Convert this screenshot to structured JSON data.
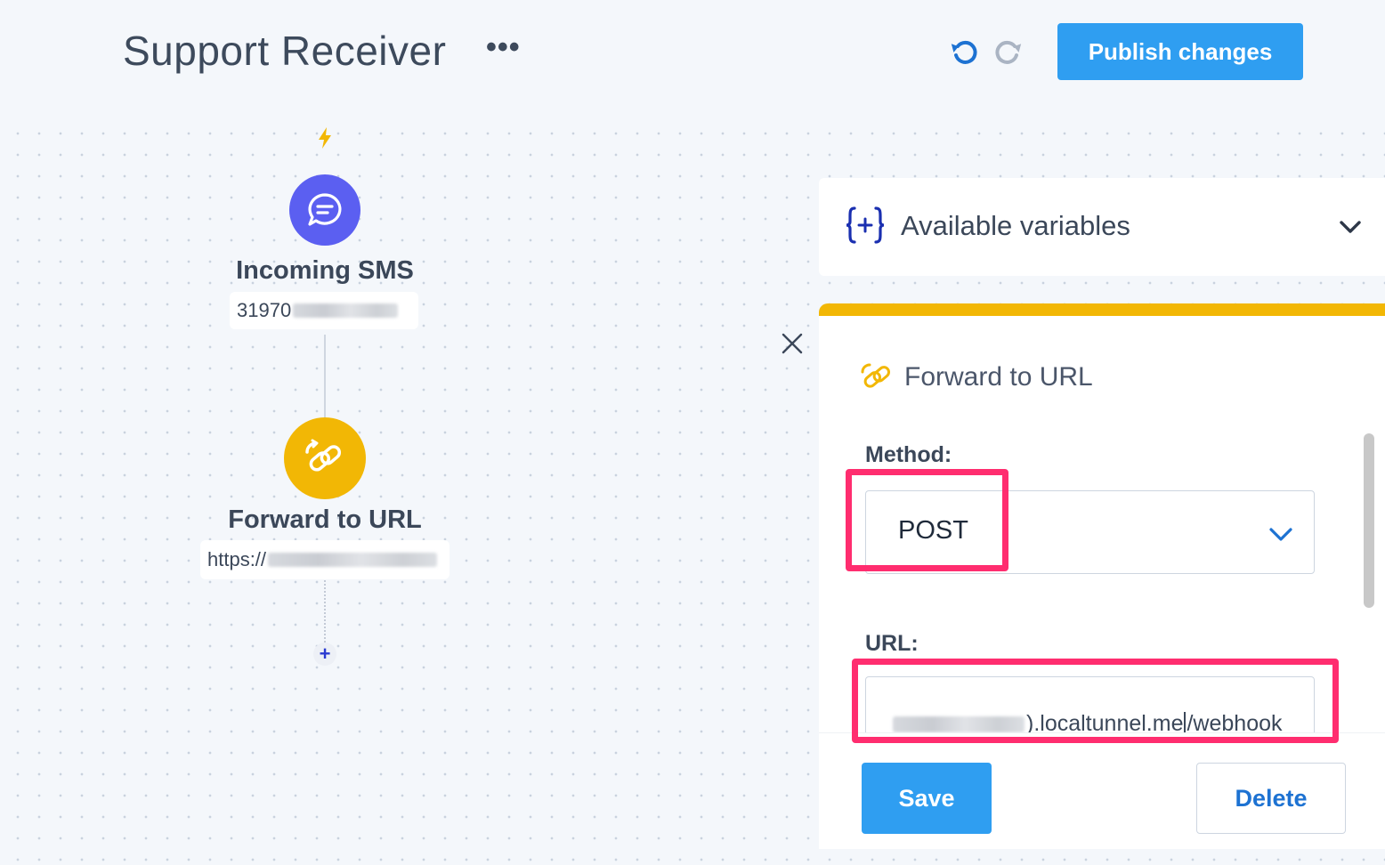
{
  "header": {
    "title": "Support Receiver",
    "more_label": "•••",
    "undo_icon": "undo-icon",
    "redo_icon": "redo-icon",
    "publish_label": "Publish changes"
  },
  "flow": {
    "trigger_icon": "lightning-bolt-icon",
    "nodes": [
      {
        "label": "Incoming SMS",
        "icon": "chat-bubble-icon",
        "color": "#5b5ff1",
        "subtitle": "31970"
      },
      {
        "label": "Forward to URL",
        "icon": "link-icon",
        "color": "#f2b705",
        "subtitle": "https://"
      }
    ],
    "add_step_label": "+"
  },
  "variables_panel": {
    "icon": "curly-braces-plus-icon",
    "title": "Available variables"
  },
  "step_panel": {
    "accent": "#f2b705",
    "icon": "link-icon",
    "title": "Forward to URL",
    "method_label": "Method:",
    "method_value": "POST",
    "url_label": "URL:",
    "url_visible_text_a": ").localtunnel.me",
    "url_visible_text_b": "/webhook",
    "save_label": "Save",
    "delete_label": "Delete"
  },
  "colors": {
    "primary": "#2f9ef1",
    "highlight": "#ff2d6f"
  }
}
